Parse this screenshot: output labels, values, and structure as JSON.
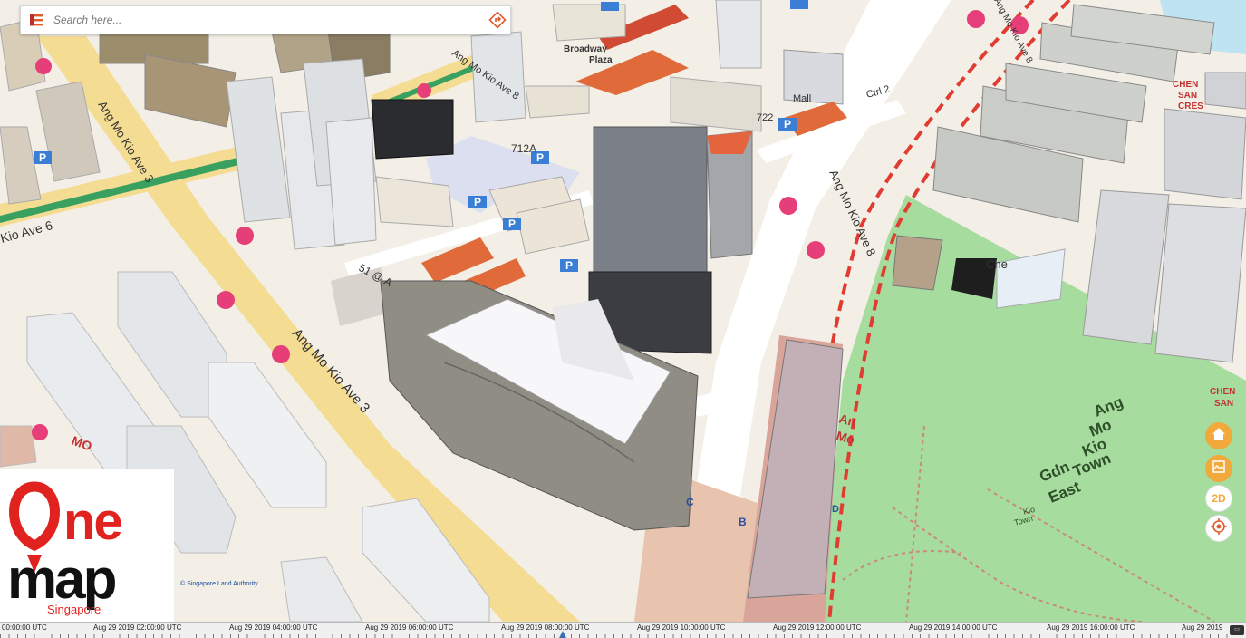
{
  "search": {
    "placeholder": "Search here..."
  },
  "map": {
    "road_labels": {
      "ave3_top": "Ang Mo Kio Ave 3",
      "ave3_bottom": "Ang Mo Kio Ave 3",
      "ave6": "Kio Ave 6",
      "ave8_top": "Ang Mo Kio Ave 8",
      "ave8_mid": "Ang Mo Kio Ave 8",
      "ave8_upper": "Ang Mo Kio Ave 8",
      "ctrl": "Ctrl 2"
    },
    "place_labels": {
      "park": "Ang\nMo\nKio\nTown\nGdn\nEast",
      "park_small": "Kio\nTown\nGdn",
      "plaza": "Broadway\nPlaza",
      "mall": "Mall",
      "blk712a": "712A",
      "blk722": "722",
      "fiftyone": "51 @ A",
      "mo": "MO",
      "chen": "CHEN\nSAN\nCRES",
      "chen2": "CHEN\nSAN",
      "ang_mo_red": "An\nMo",
      "exit_b": "B",
      "exit_c": "C",
      "exit_d": "D",
      "che": "Che"
    },
    "colors": {
      "background": "#f3efe6",
      "road_major": "#f5dc93",
      "road_minor": "#ffffff",
      "park": "#a6dc9e",
      "mrt_line": "#e03c31",
      "poi": "#e63e78",
      "parking": "#3a7fd5",
      "accent": "#f2a93b"
    }
  },
  "controls": {
    "home": "home-icon",
    "layers": "layers-icon",
    "mode_2d": "2D",
    "locate": "locate-icon"
  },
  "logo": {
    "line1": "One",
    "line2": "map",
    "line3": "Singapore"
  },
  "attribution": "© Singapore Land Authority",
  "timeline": {
    "labels": [
      "00:00:00 UTC",
      "Aug 29 2019 02:00:00 UTC",
      "Aug 29 2019 04:00:00 UTC",
      "Aug 29 2019 06:00:00 UTC",
      "Aug 29 2019 08:00:00 UTC",
      "Aug 29 2019 10:00:00 UTC",
      "Aug 29 2019 12:00:00 UTC",
      "Aug 29 2019 14:00:00 UTC",
      "Aug 29 2019 16:00:00 UTC",
      "Aug 29 2019"
    ]
  }
}
